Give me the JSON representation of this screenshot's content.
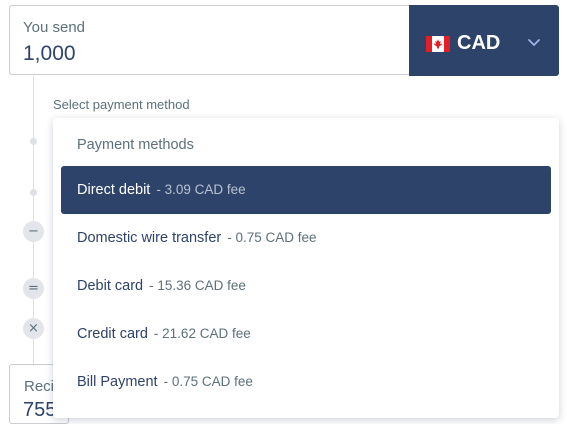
{
  "send": {
    "label": "You send",
    "amount": "1,000"
  },
  "currency": {
    "code": "CAD",
    "flag": "canada-flag"
  },
  "payment": {
    "section_label": "Select payment method"
  },
  "timeline": {
    "minus_symbol": "−",
    "equals_symbol": "=",
    "times_symbol": "×"
  },
  "recipient": {
    "label": "Reci",
    "amount": "755"
  },
  "dropdown": {
    "header": "Payment methods",
    "selected_index": 0,
    "options": [
      {
        "name": "Direct debit",
        "fee": "- 3.09 CAD fee"
      },
      {
        "name": "Domestic wire transfer",
        "fee": "- 0.75 CAD fee"
      },
      {
        "name": "Debit card",
        "fee": "- 15.36 CAD fee"
      },
      {
        "name": "Credit card",
        "fee": "- 21.62 CAD fee"
      },
      {
        "name": "Bill Payment",
        "fee": "- 0.75 CAD fee"
      }
    ]
  },
  "colors": {
    "navy": "#2e4369",
    "muted": "#5d7079",
    "flag_red": "#e31e24"
  }
}
